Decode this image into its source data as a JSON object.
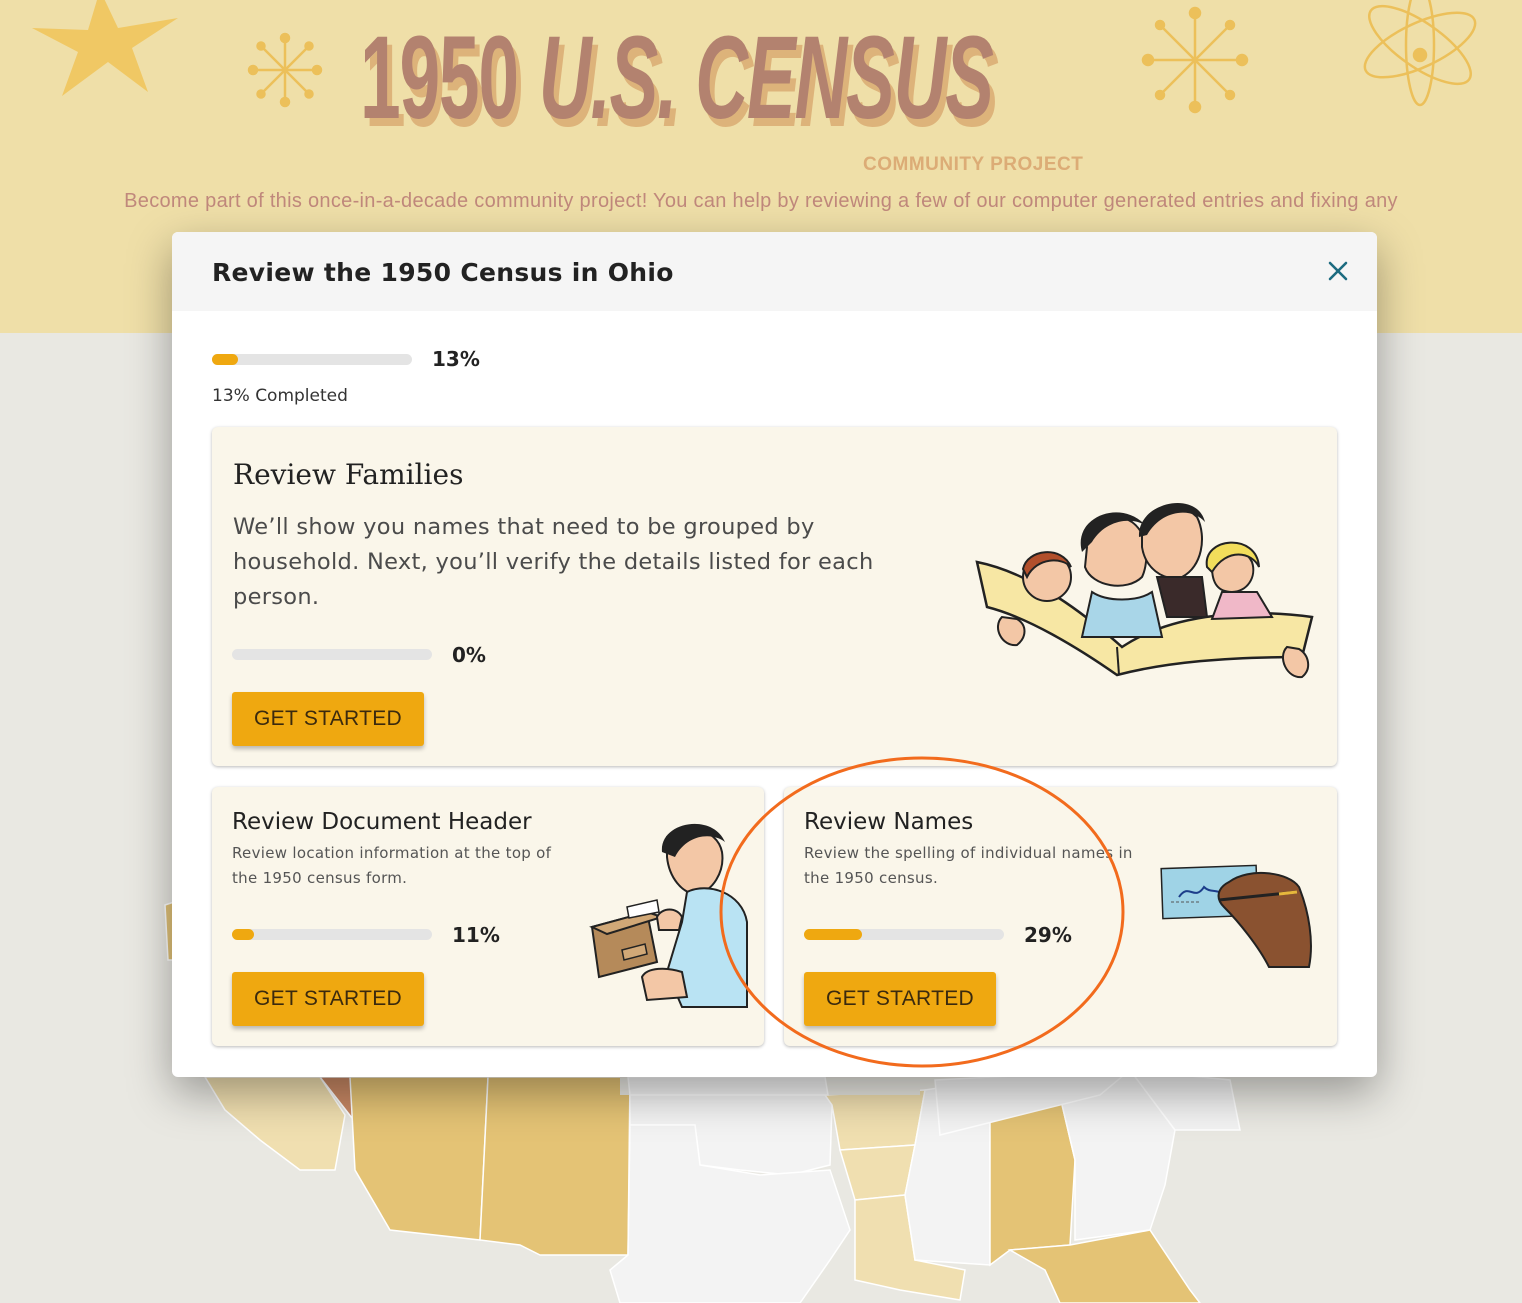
{
  "hero": {
    "title_year": "1950",
    "title_rest": "U.S. CENSUS",
    "subtitle": "COMMUNITY PROJECT",
    "intro": "Become part of this once-in-a-decade community project! You can help by reviewing a few of our computer generated entries and fixing any"
  },
  "modal": {
    "title": "Review the 1950 Census in Ohio",
    "overall": {
      "percent_label": "13%",
      "completed_label": "13% Completed",
      "progress": 0.13
    },
    "cards": [
      {
        "title": "Review Families",
        "description": "We’ll show you names that need to be grouped by household. Next, you’ll verify the details listed for each person.",
        "percent_label": "0%",
        "progress": 0.0,
        "button": "GET STARTED"
      },
      {
        "title": "Review Document Header",
        "description": "Review location information at the top of the 1950 census form.",
        "percent_label": "11%",
        "progress": 0.11,
        "button": "GET STARTED"
      },
      {
        "title": "Review Names",
        "description": "Review the spelling of individual names in the 1950 census.",
        "percent_label": "29%",
        "progress": 0.29,
        "button": "GET STARTED"
      }
    ]
  },
  "colors": {
    "accent": "#efa810",
    "hero_bg": "#efdfa8",
    "title": "#b3826f",
    "highlight_annotation": "#f26b1d"
  },
  "icons": [
    "close-icon",
    "starburst-icon",
    "atom-icon"
  ]
}
